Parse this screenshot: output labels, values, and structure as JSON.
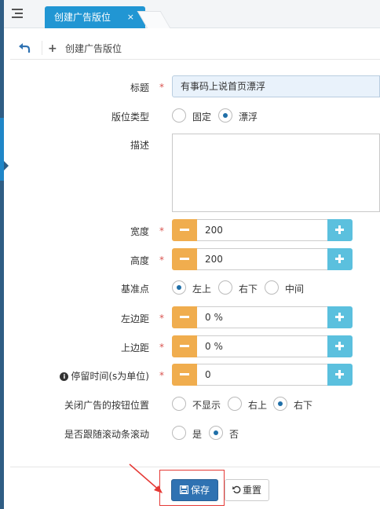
{
  "tabs": {
    "active_label": "创建广告版位",
    "close_glyph": "×"
  },
  "toolbar": {
    "create_label": "创建广告版位"
  },
  "form": {
    "required_mark": "*",
    "title": {
      "label": "标题",
      "value": "有事码上说首页漂浮"
    },
    "type": {
      "label": "版位类型",
      "options": [
        "固定",
        "漂浮"
      ],
      "selected": "漂浮"
    },
    "description": {
      "label": "描述",
      "value": ""
    },
    "width": {
      "label": "宽度",
      "value": "200"
    },
    "height": {
      "label": "高度",
      "value": "200"
    },
    "anchor": {
      "label": "基准点",
      "options": [
        "左上",
        "右下",
        "中间"
      ],
      "selected": "左上"
    },
    "margin_left": {
      "label": "左边距",
      "value": "0 %"
    },
    "margin_top": {
      "label": "上边距",
      "value": "0 %"
    },
    "duration": {
      "label": "停留时间(s为单位)",
      "value": "0",
      "icon": "info-icon"
    },
    "close_button_position": {
      "label": "关闭广告的按钮位置",
      "options": [
        "不显示",
        "右上",
        "右下"
      ],
      "selected": "右下"
    },
    "follow_scroll": {
      "label": "是否跟随滚动条滚动",
      "options": [
        "是",
        "否"
      ],
      "selected": "否"
    }
  },
  "footer": {
    "save_label": "保存",
    "reset_label": "重置"
  },
  "colors": {
    "primary": "#2f72b2",
    "tab_active": "#2196d3",
    "minus": "#f0ad4e",
    "plus": "#5bc0de",
    "required": "#d9534f",
    "annotation": "#e53935"
  }
}
